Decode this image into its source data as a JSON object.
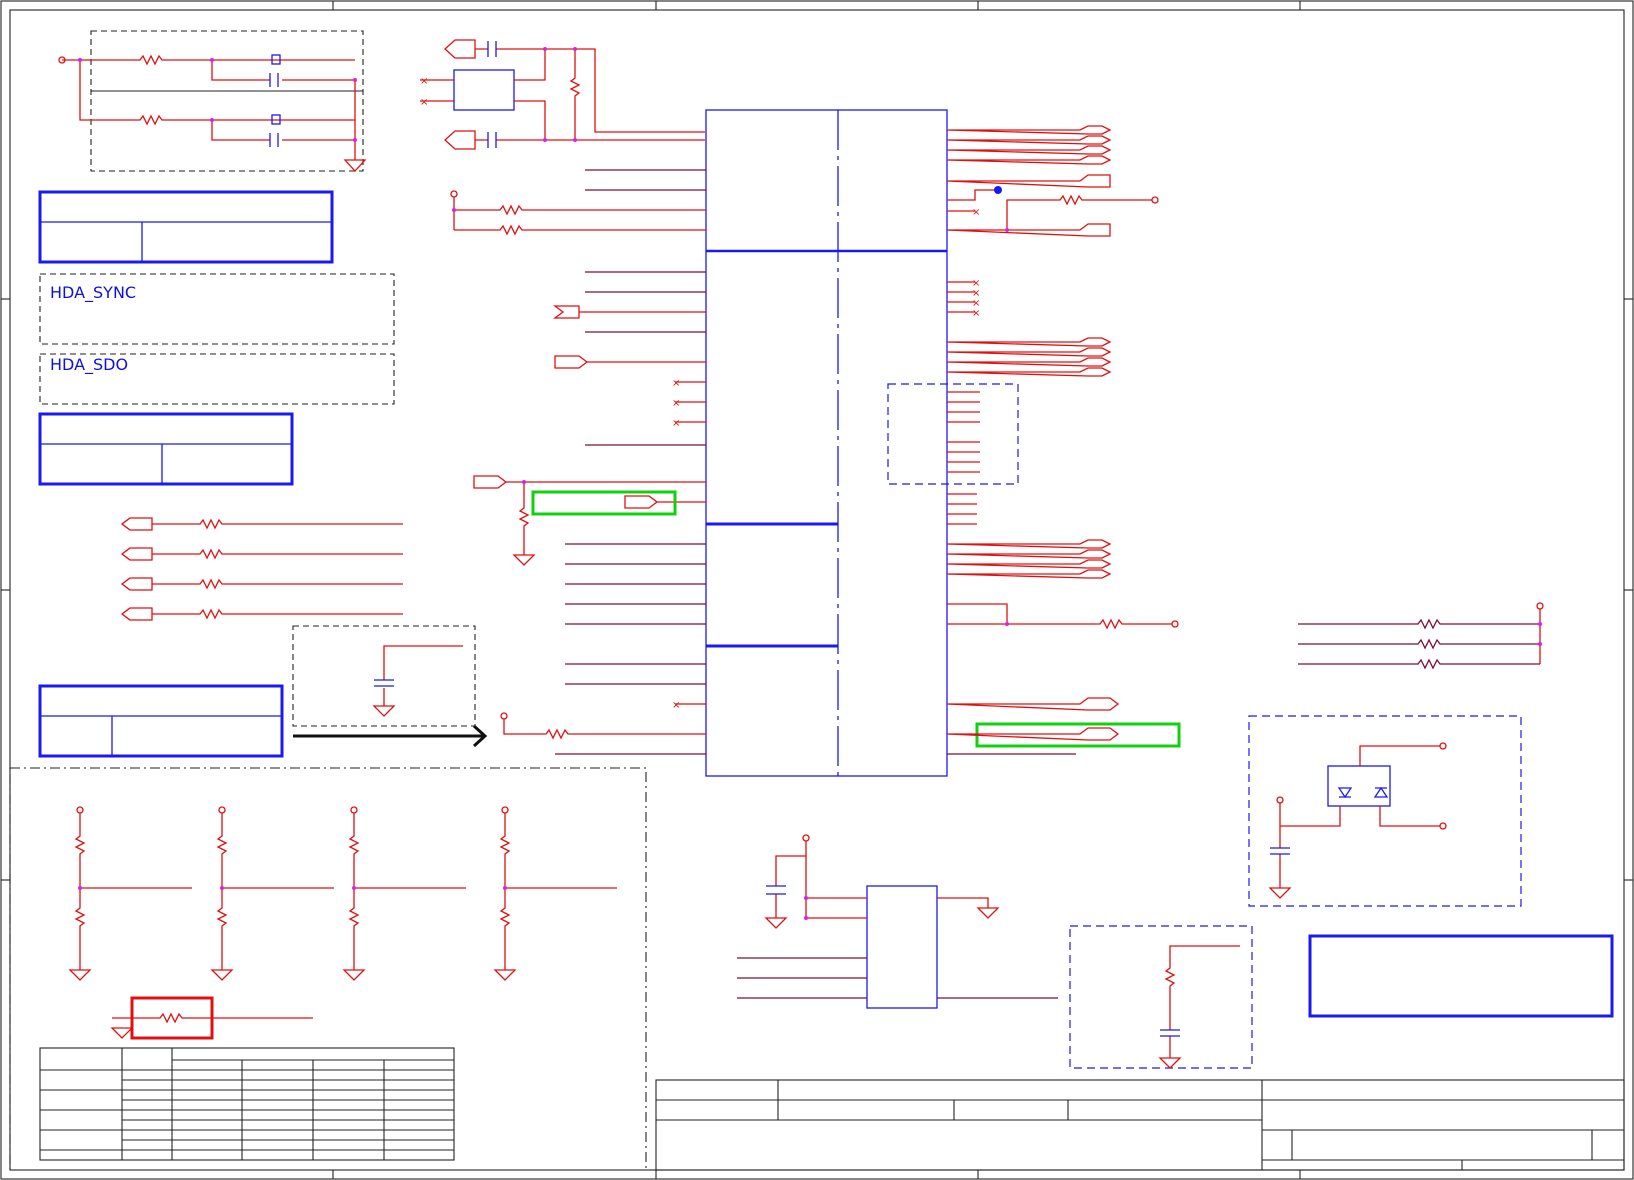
{
  "labels": {
    "hda_sync": "HDA_SYNC",
    "hda_sdo": "HDA_SDO"
  },
  "colors": {
    "wire": "#e01010",
    "net": "#7a1030",
    "component": "#1a1aee",
    "highlight_green": "#10d010",
    "highlight_red": "#e01010",
    "junction": "#e020e0"
  }
}
